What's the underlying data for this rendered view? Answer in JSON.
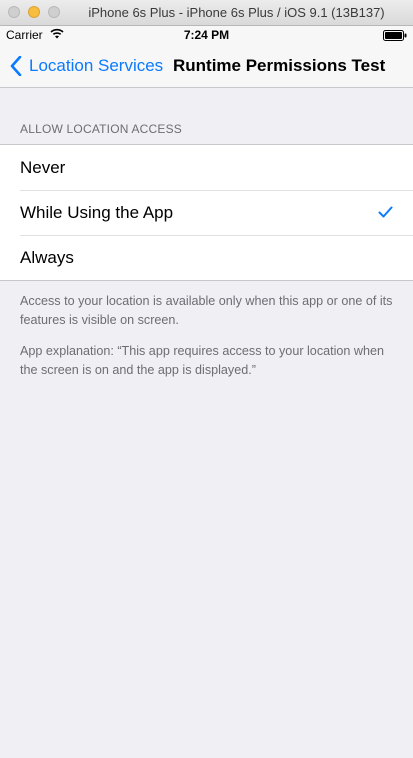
{
  "simulator": {
    "window_title": "iPhone 6s Plus - iPhone 6s Plus / iOS 9.1 (13B137)"
  },
  "status_bar": {
    "carrier": "Carrier",
    "time": "7:24 PM",
    "icons": [
      "wifi-icon",
      "battery-icon"
    ]
  },
  "nav": {
    "back_label": "Location Services",
    "back_icon": "chevron-left-icon",
    "title": "Runtime Permissions Test"
  },
  "section": {
    "header": "ALLOW LOCATION ACCESS",
    "options": [
      {
        "label": "Never",
        "selected": false
      },
      {
        "label": "While Using the App",
        "selected": true
      },
      {
        "label": "Always",
        "selected": false
      }
    ],
    "footer_text": "Access to your location is available only when this app or one of its features is visible on screen.",
    "explanation": "App explanation: “This app requires access to your location when the screen is on and the app is displayed.”"
  },
  "colors": {
    "accent": "#0a7aff",
    "background": "#efeff4",
    "secondary_text": "#6d6d72"
  }
}
